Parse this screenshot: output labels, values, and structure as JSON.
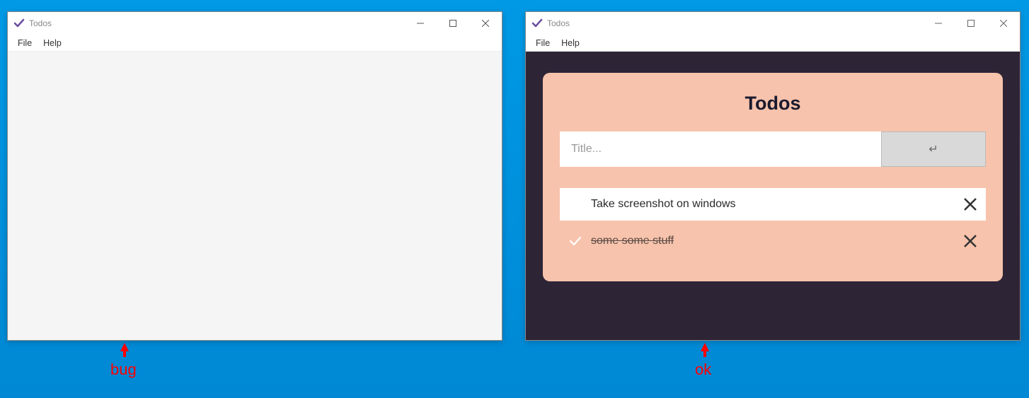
{
  "desktop": {
    "background_color": "#0099e5"
  },
  "window_left": {
    "title": "Todos",
    "menubar": {
      "file": "File",
      "help": "Help"
    }
  },
  "window_right": {
    "title": "Todos",
    "menubar": {
      "file": "File",
      "help": "Help"
    },
    "app": {
      "heading": "Todos",
      "input_placeholder": "Title...",
      "submit_symbol": "↵",
      "items": [
        {
          "text": "Take screenshot on windows",
          "done": false
        },
        {
          "text": "some some stuff",
          "done": true
        }
      ]
    }
  },
  "annotations": {
    "left_label": "bug",
    "right_label": "ok"
  },
  "colors": {
    "panel_bg": "#f7c3ac",
    "dark_bg": "#2d2436",
    "accent": "#6b4e9e"
  }
}
